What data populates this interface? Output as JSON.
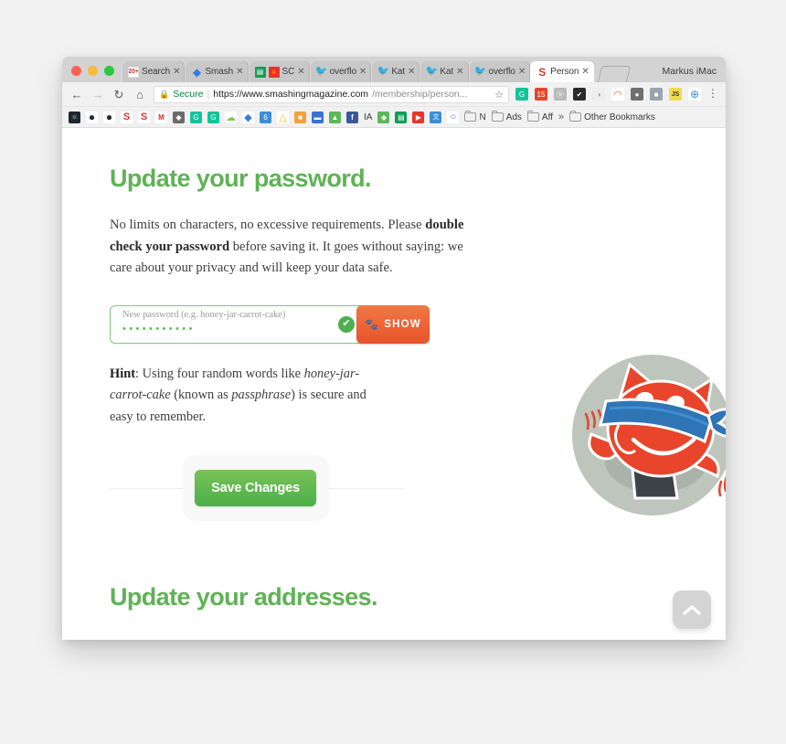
{
  "browser": {
    "profile_name": "Markus iMac",
    "tabs": [
      {
        "title": "Search",
        "favicon": "gmail-icon",
        "active": false,
        "badge": "20+"
      },
      {
        "title": "Smash",
        "favicon": "dropbox-icon",
        "active": false
      },
      {
        "title": "SC",
        "favicon": "sheets-icon",
        "active": false,
        "extra_favicon": "canada-flag-icon"
      },
      {
        "title": "overflo",
        "favicon": "twitter-icon",
        "active": false
      },
      {
        "title": "Kat",
        "favicon": "twitter-icon",
        "active": false
      },
      {
        "title": "Kat",
        "favicon": "twitter-icon",
        "active": false
      },
      {
        "title": "overflo",
        "favicon": "twitter-icon",
        "active": false
      },
      {
        "title": "Person",
        "favicon": "smashing-icon",
        "active": true
      }
    ],
    "close_glyph": "✕",
    "omnibox": {
      "back_glyph": "←",
      "forward_glyph": "→",
      "reload_glyph": "↻",
      "home_glyph": "⌂",
      "lock_glyph": "🔒",
      "secure_label": "Secure",
      "divider": "|",
      "url_host": "https://www.smashingmagazine.com",
      "url_path": "/membership/person...",
      "star_glyph": "☆",
      "menu_glyph": "⋮",
      "extensions": [
        {
          "name": "grammarly-extension",
          "glyph": "G",
          "color": "#15c39a"
        },
        {
          "name": "calendar-extension",
          "glyph": "15",
          "color": "#e8452c"
        },
        {
          "name": "bp-extension",
          "glyph": "ⓑ",
          "color": "#b9b9b9"
        },
        {
          "name": "checkmark-extension",
          "glyph": "✔",
          "color": "#2b2b2b"
        },
        {
          "name": "moon-extension",
          "glyph": "◑",
          "color": "#d0d0d0"
        },
        {
          "name": "rainbow-extension",
          "glyph": "◠",
          "color": "#e8642c"
        },
        {
          "name": "ghostery-extension",
          "glyph": "●",
          "color": "#6f6f6f"
        },
        {
          "name": "pocket-extension",
          "glyph": "■",
          "color": "#9aa3ad"
        },
        {
          "name": "js-extension",
          "glyph": "JS",
          "color": "#f0db4f"
        },
        {
          "name": "globe-extension",
          "glyph": "⊕",
          "color": "#3a8fd6"
        }
      ]
    },
    "bookmarks": {
      "icons": [
        {
          "name": "react-bookmark",
          "glyph": "⚛",
          "color": "#20232a"
        },
        {
          "name": "github-bookmark",
          "glyph": "●",
          "color": "#ffffff",
          "fg": "#24292e"
        },
        {
          "name": "github-bookmark-2",
          "glyph": "●",
          "color": "#ffffff",
          "fg": "#24292e"
        },
        {
          "name": "smashing-bookmark",
          "glyph": "S",
          "color": "#ffffff",
          "fg": "#d33a2c"
        },
        {
          "name": "smashing-bookmark-2",
          "glyph": "S",
          "color": "#ffffff",
          "fg": "#d33a2c"
        },
        {
          "name": "gmail-bookmark",
          "glyph": "M",
          "color": "#ffffff",
          "fg": "#d93025"
        },
        {
          "name": "badge-bookmark",
          "glyph": "◆",
          "color": "#6b6b6b"
        },
        {
          "name": "grammarly-bookmark",
          "glyph": "G",
          "color": "#15c39a"
        },
        {
          "name": "grammarly-bookmark-2",
          "glyph": "G",
          "color": "#15c39a"
        },
        {
          "name": "cloud-bookmark",
          "glyph": "☁",
          "color": "#7ec95a"
        },
        {
          "name": "dropbox-bookmark",
          "glyph": "◆",
          "color": "#2f7fe0"
        },
        {
          "name": "sixth-bookmark",
          "glyph": "6",
          "color": "#3a8fd6"
        },
        {
          "name": "drive-bookmark",
          "glyph": "△",
          "color": "#fbbc05"
        },
        {
          "name": "orange-bookmark",
          "glyph": "■",
          "color": "#f2a13c"
        },
        {
          "name": "book-bookmark",
          "glyph": "▬",
          "color": "#3a6fd6"
        },
        {
          "name": "evernote-bookmark",
          "glyph": "▲",
          "color": "#5bb85b"
        },
        {
          "name": "facebook-bookmark",
          "glyph": "f",
          "color": "#3b5998"
        }
      ],
      "ia_label": "IA",
      "icons2": [
        {
          "name": "evernote-bookmark-2",
          "glyph": "◆",
          "color": "#5bb85b"
        },
        {
          "name": "sheets-bookmark",
          "glyph": "▤",
          "color": "#0f9d58"
        },
        {
          "name": "youtube-bookmark",
          "glyph": "▶",
          "color": "#e8342a"
        },
        {
          "name": "translate-bookmark",
          "glyph": "文",
          "color": "#3a8fd6"
        },
        {
          "name": "codepen-bookmark",
          "glyph": "○",
          "color": "#ffffff",
          "fg": "#2f7fe0"
        }
      ],
      "folders": [
        "N",
        "Ads",
        "Aff"
      ],
      "overflow_glyph": "»",
      "other_bookmarks": "Other Bookmarks"
    }
  },
  "page": {
    "heading": "Update your password.",
    "intro": {
      "part1": "No limits on characters, no excessive requirements. Please ",
      "bold": "double check your password",
      "part2": " before saving it. It goes without saying: we care about your privacy and will keep your data safe."
    },
    "password_field": {
      "label": "New password (e.g. honey-jar-carrot-cake)",
      "value": "•••••••••••",
      "valid_glyph": "✔",
      "show_button_label": "SHOW",
      "paw_glyph": "🐾"
    },
    "hint": {
      "label": "Hint",
      "part1": ": Using four random words like ",
      "italic1": "honey-jar-carrot-cake",
      "part2": " (known as ",
      "italic2": "passphrase",
      "part3": ") is secure and easy to remember."
    },
    "save_button_label": "Save Changes",
    "bottom_heading": "Update your addresses.",
    "back_to_top_glyph": "∧",
    "colors": {
      "heading_green": "#5fb255",
      "save_green": "#4cb04a",
      "show_orange": "#e8542a",
      "field_border": "#7ec97a"
    }
  }
}
